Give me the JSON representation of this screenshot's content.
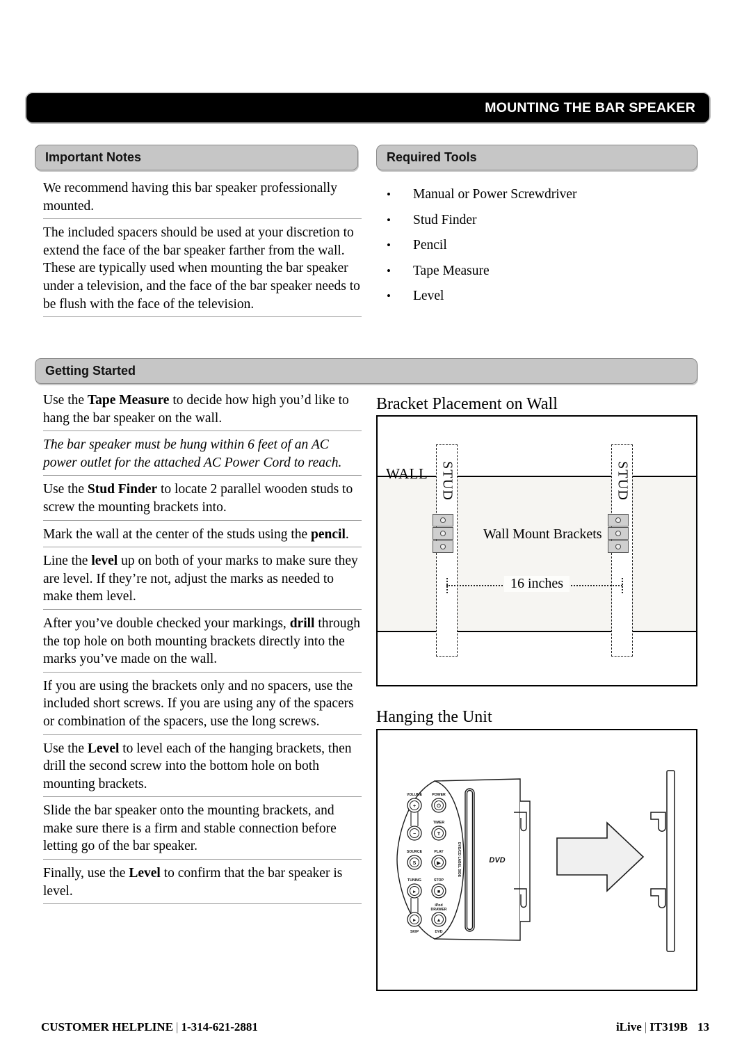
{
  "header": {
    "title": "MOUNTING THE BAR SPEAKER"
  },
  "sections": {
    "important_notes": {
      "title": "Important Notes",
      "paragraphs": [
        "We recommend having this bar speaker professionally mounted.",
        "The included spacers should be used at your discretion to extend the face of the bar speaker farther from the wall. These are typically used when mounting the bar speaker under a television, and the face of the bar speaker needs to be flush with the face of the television."
      ]
    },
    "required_tools": {
      "title": "Required Tools",
      "items": [
        "Manual or Power Screwdriver",
        "Stud Finder",
        "Pencil",
        "Tape Measure",
        "Level"
      ]
    },
    "getting_started": {
      "title": "Getting Started",
      "steps": [
        {
          "html": "Use the <b>Tape Measure</b> to decide how high you’d like to hang the bar speaker on the wall.",
          "italic": false
        },
        {
          "html": "The bar speaker must be hung within 6 feet of an AC power outlet for the attached AC Power Cord to reach.",
          "italic": true
        },
        {
          "html": "Use the <b>Stud Finder</b> to locate 2 parallel wooden studs to screw the mounting brackets into.",
          "italic": false
        },
        {
          "html": "Mark the wall at the center of the studs using the <b>pencil</b>.",
          "italic": false
        },
        {
          "html": "Line the <b>level</b> up on both of your marks to make sure they are level. If they’re not, adjust the marks as needed to make them level.",
          "italic": false
        },
        {
          "html": "After you’ve double checked your markings, <b>drill</b> through the top hole on both mounting brackets directly into the marks you’ve made on the wall.",
          "italic": false
        },
        {
          "html": "If you are using the brackets only and no spacers, use the included short screws. If you are using any of the spacers or combination of the spacers, use the long screws.",
          "italic": false
        },
        {
          "html": "Use the <b>Level</b> to level each of the hanging brackets, then drill the second screw into the bottom hole on both mounting brackets.",
          "italic": false
        },
        {
          "html": "Slide the bar speaker onto the mounting brackets, and make sure there is a firm and stable connection before letting go of the bar speaker.",
          "italic": false
        },
        {
          "html": "Finally, use the <b>Level</b> to confirm that the bar speaker is level.",
          "italic": false
        }
      ]
    }
  },
  "figures": {
    "bracket_placement": {
      "title": "Bracket Placement on Wall",
      "wall_label": "WALL",
      "stud_label_left": "STUD",
      "stud_label_right": "STUD",
      "brackets_label": "Wall Mount Brackets",
      "dimension_label": "16 inches"
    },
    "hanging_unit": {
      "title": "Hanging the Unit",
      "disc_side_label": "DVD/CD LABEL SIDE",
      "disc_slot_label": "DVD",
      "controls": [
        {
          "label": "VOLUME",
          "glyph": "+"
        },
        {
          "label": "",
          "glyph": "−"
        },
        {
          "label": "POWER",
          "glyph": "⏻"
        },
        {
          "label": "TIMER",
          "glyph": "T"
        },
        {
          "label": "SOURCE",
          "glyph": "S"
        },
        {
          "label": "PLAY",
          "glyph": "▶❘"
        },
        {
          "label": "TUNING",
          "glyph": "▸▸"
        },
        {
          "label": "STOP",
          "glyph": "■"
        },
        {
          "label": "SKIP",
          "glyph": "▸▸"
        },
        {
          "label": "iPod DRAWER",
          "glyph": "▲"
        },
        {
          "label": "DVD",
          "glyph": ""
        }
      ]
    }
  },
  "footer": {
    "helpline_label": "CUSTOMER HELPLINE",
    "separator": "|",
    "phone": "1-314-621-2881",
    "brand": "iLive",
    "model": "IT319B",
    "page": "13"
  },
  "colors": {
    "header_bg": "#000000",
    "section_bar_bg": "#c6c6c6",
    "wall_fill": "#f6f5f2",
    "bracket_fill": "#cfcfcf"
  }
}
